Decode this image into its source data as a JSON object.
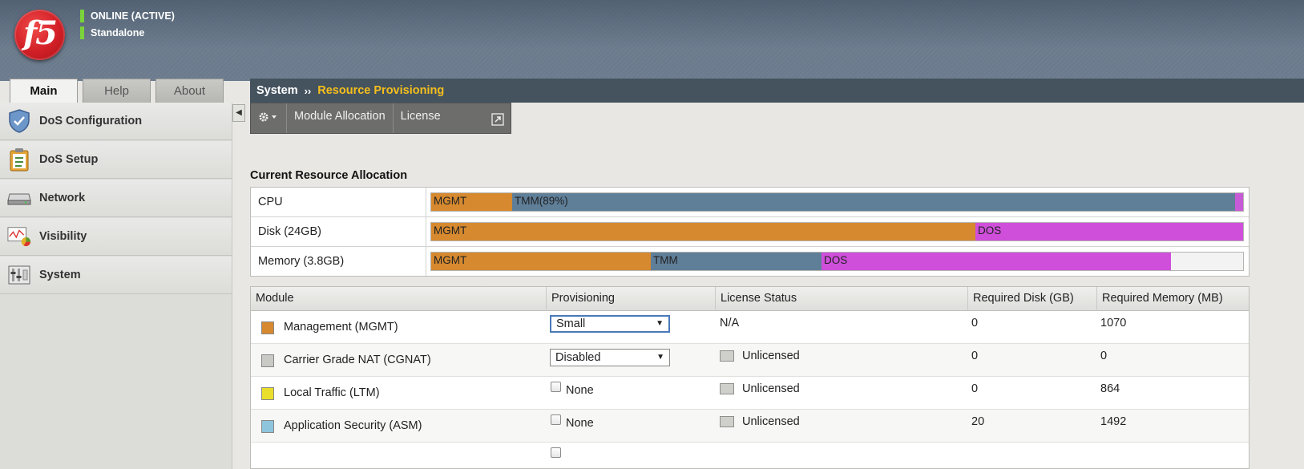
{
  "header": {
    "logo_text": "f5",
    "status_primary": "ONLINE (ACTIVE)",
    "status_secondary": "Standalone",
    "status_color": "#7bd23b"
  },
  "tabs": [
    {
      "label": "Main",
      "active": true
    },
    {
      "label": "Help",
      "active": false
    },
    {
      "label": "About",
      "active": false
    }
  ],
  "sidebar": {
    "items": [
      {
        "label": "DoS Configuration",
        "icon": "shield-icon"
      },
      {
        "label": "DoS Setup",
        "icon": "clipboard-icon"
      },
      {
        "label": "Network",
        "icon": "network-device-icon"
      },
      {
        "label": "Visibility",
        "icon": "chart-monitor-icon"
      },
      {
        "label": "System",
        "icon": "system-panel-icon"
      }
    ],
    "collapse_glyph": "◀"
  },
  "breadcrumb": {
    "section": "System",
    "separator": "››",
    "page": "Resource Provisioning"
  },
  "subnav": {
    "gear_icon": "gear-icon",
    "items": [
      "Module Allocation",
      "License"
    ],
    "external_icon": "external-link-icon"
  },
  "allocation": {
    "title": "Current Resource Allocation",
    "rows": [
      {
        "label": "CPU",
        "segments": [
          {
            "label": "MGMT",
            "fraction": 0.1,
            "color": "#d6892f"
          },
          {
            "label": "TMM(89%)",
            "fraction": 0.89,
            "color": "#5f7f99"
          },
          {
            "label": "",
            "fraction": 0.01,
            "color": "#c75ad6"
          }
        ]
      },
      {
        "label": "Disk (24GB)",
        "segments": [
          {
            "label": "MGMT",
            "fraction": 0.67,
            "color": "#d6892f"
          },
          {
            "label": "DOS",
            "fraction": 0.33,
            "color": "#cf4fdb"
          }
        ]
      },
      {
        "label": "Memory (3.8GB)",
        "segments": [
          {
            "label": "MGMT",
            "fraction": 0.27,
            "color": "#d6892f"
          },
          {
            "label": "TMM",
            "fraction": 0.21,
            "color": "#5f7f99"
          },
          {
            "label": "DOS",
            "fraction": 0.43,
            "color": "#cf4fdb"
          }
        ]
      }
    ]
  },
  "modules": {
    "columns": [
      "Module",
      "Provisioning",
      "License Status",
      "Required Disk (GB)",
      "Required Memory (MB)"
    ],
    "rows": [
      {
        "name": "Management (MGMT)",
        "swatch": "#d6892f",
        "control": "select",
        "provisioning": "Small",
        "license": "N/A",
        "licensed_icon": false,
        "disk": "0",
        "memory": "1070"
      },
      {
        "name": "Carrier Grade NAT (CGNAT)",
        "swatch": "#c9c9c6",
        "control": "select",
        "provisioning": "Disabled",
        "license": "Unlicensed",
        "licensed_icon": true,
        "disk": "0",
        "memory": "0"
      },
      {
        "name": "Local Traffic (LTM)",
        "swatch": "#e9df2a",
        "control": "checkbox",
        "provisioning": "None",
        "license": "Unlicensed",
        "licensed_icon": true,
        "disk": "0",
        "memory": "864"
      },
      {
        "name": "Application Security (ASM)",
        "swatch": "#8ec4dc",
        "control": "checkbox",
        "provisioning": "None",
        "license": "Unlicensed",
        "licensed_icon": true,
        "disk": "20",
        "memory": "1492"
      }
    ]
  }
}
